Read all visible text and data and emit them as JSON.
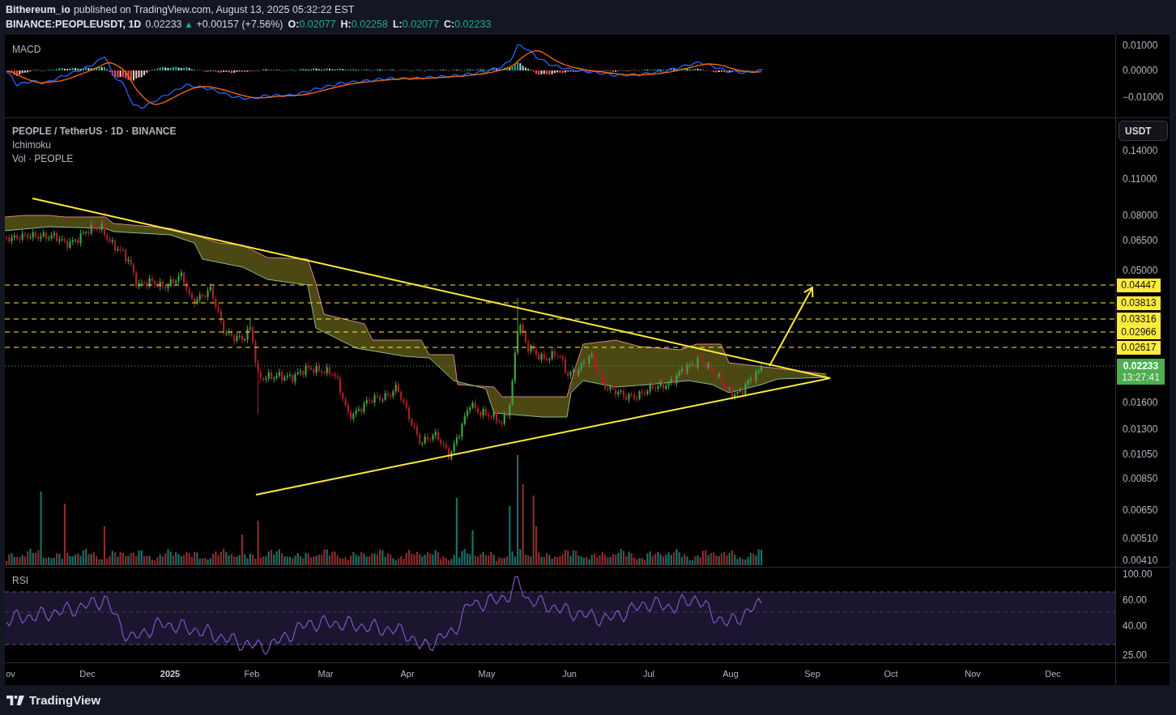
{
  "header": {
    "author": "Bithereum_io",
    "published": "published on TradingView.com, August 13, 2025 05:32:22 EST"
  },
  "symbol_bar": {
    "symbol": "BINANCE:PEOPLEUSDT, 1D",
    "last": "0.02233",
    "arrow": "▲",
    "change": "+0.00157 (+7.56%)",
    "ohlc": [
      {
        "label": "O:",
        "value": "0.02077"
      },
      {
        "label": "H:",
        "value": "0.02258"
      },
      {
        "label": "L:",
        "value": "0.02077"
      },
      {
        "label": "C:",
        "value": "0.02233"
      }
    ]
  },
  "macd_pane": {
    "title": "MACD",
    "axis_ticks": [
      "0.01000",
      "0.00000",
      "−0.01000"
    ]
  },
  "price_pane": {
    "legend": {
      "symbol": "PEOPLE / TetherUS · 1D · BINANCE",
      "indicators": [
        "Ichimoku",
        "Vol · PEOPLE"
      ]
    },
    "currency_button": "USDT",
    "axis_ticks": [
      "0.14000",
      "0.11000",
      "0.08000",
      "0.06500",
      "0.05000",
      "0.01600",
      "0.01300",
      "0.01050",
      "0.00850",
      "0.00650",
      "0.00510",
      "0.00410"
    ],
    "levels": [
      "0.04447",
      "0.03813",
      "0.03316",
      "0.02966",
      "0.02617"
    ],
    "last_price": {
      "price": "0.02233",
      "countdown": "13:27:41"
    }
  },
  "rsi_pane": {
    "title": "RSI",
    "axis_ticks": [
      "100.00",
      "60.00",
      "40.00",
      "25.00"
    ]
  },
  "time_axis": [
    {
      "label": "ov",
      "kind": "month"
    },
    {
      "label": "Dec",
      "kind": "month"
    },
    {
      "label": "2025",
      "kind": "year"
    },
    {
      "label": "Feb",
      "kind": "month"
    },
    {
      "label": "Mar",
      "kind": "month"
    },
    {
      "label": "Apr",
      "kind": "month"
    },
    {
      "label": "May",
      "kind": "month"
    },
    {
      "label": "Jun",
      "kind": "month"
    },
    {
      "label": "Jul",
      "kind": "month"
    },
    {
      "label": "Aug",
      "kind": "month"
    },
    {
      "label": "Sep",
      "kind": "month"
    },
    {
      "label": "Oct",
      "kind": "month"
    },
    {
      "label": "Nov",
      "kind": "month"
    },
    {
      "label": "Dec",
      "kind": "month"
    }
  ],
  "footer": {
    "brand": "TradingView"
  }
}
